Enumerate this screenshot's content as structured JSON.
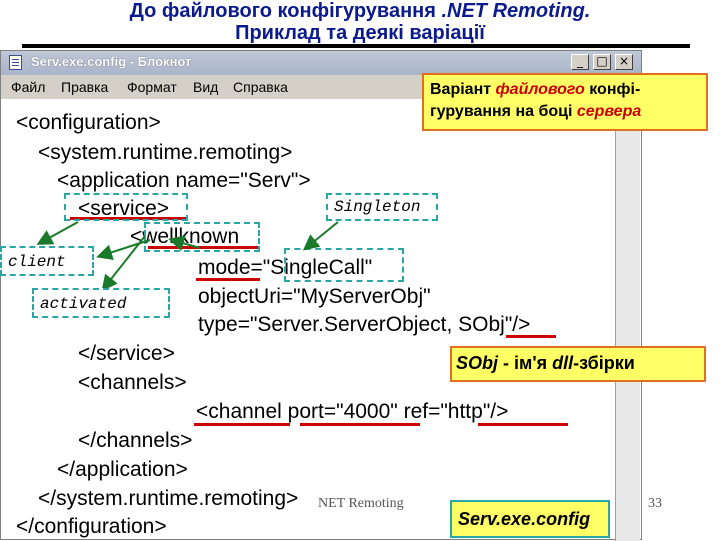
{
  "slide": {
    "title_line1_a": "До файлового конфігурування ",
    "title_line1_b": ".NET Remoting.",
    "title_line2": "Приклад та деякі варіації",
    "footer_left": "NET Remoting",
    "page_number": "33"
  },
  "window": {
    "title": "Serv.exe.config - Блокнот",
    "buttons": [
      "_",
      "□",
      "×"
    ],
    "menu": [
      "Файл",
      "Правка",
      "Формат",
      "Вид",
      "Справка"
    ]
  },
  "code_lines": [
    "<configuration>",
    "<system.runtime.remoting>",
    "<application name=\"Serv\">",
    "<service>",
    "<wellknown",
    "mode=\"SingleCall\"",
    "objectUri=\"MyServerObj\"",
    "type=\"Server.ServerObject, SObj\"/>",
    "</service>",
    "<channels>",
    "<channel port=\"4000\" ref=\"http\"/>",
    "</channels>",
    "</application>",
    "</system.runtime.remoting>",
    "</configuration>"
  ],
  "callouts": {
    "variant_a": "Варіант ",
    "variant_b": "файлового",
    "variant_c": " конфі-",
    "variant_d": "гурування на боці ",
    "variant_e": "сервера",
    "singleton": "Singleton",
    "client": "client",
    "activated": "activated",
    "sobj_a": "SObj",
    "sobj_b": " - ім'я ",
    "sobj_c": "dll",
    "sobj_d": "-збірки",
    "file_name": "Serv.exe.config"
  },
  "colors": {
    "title_blue": "#0b1a8c",
    "underline_red": "#cc0000",
    "callout_yellow": "#ffff66",
    "dash_teal": "#2aa6a6",
    "arrow_green": "#1a7a2a"
  },
  "icons": [
    "notepad-icon"
  ]
}
